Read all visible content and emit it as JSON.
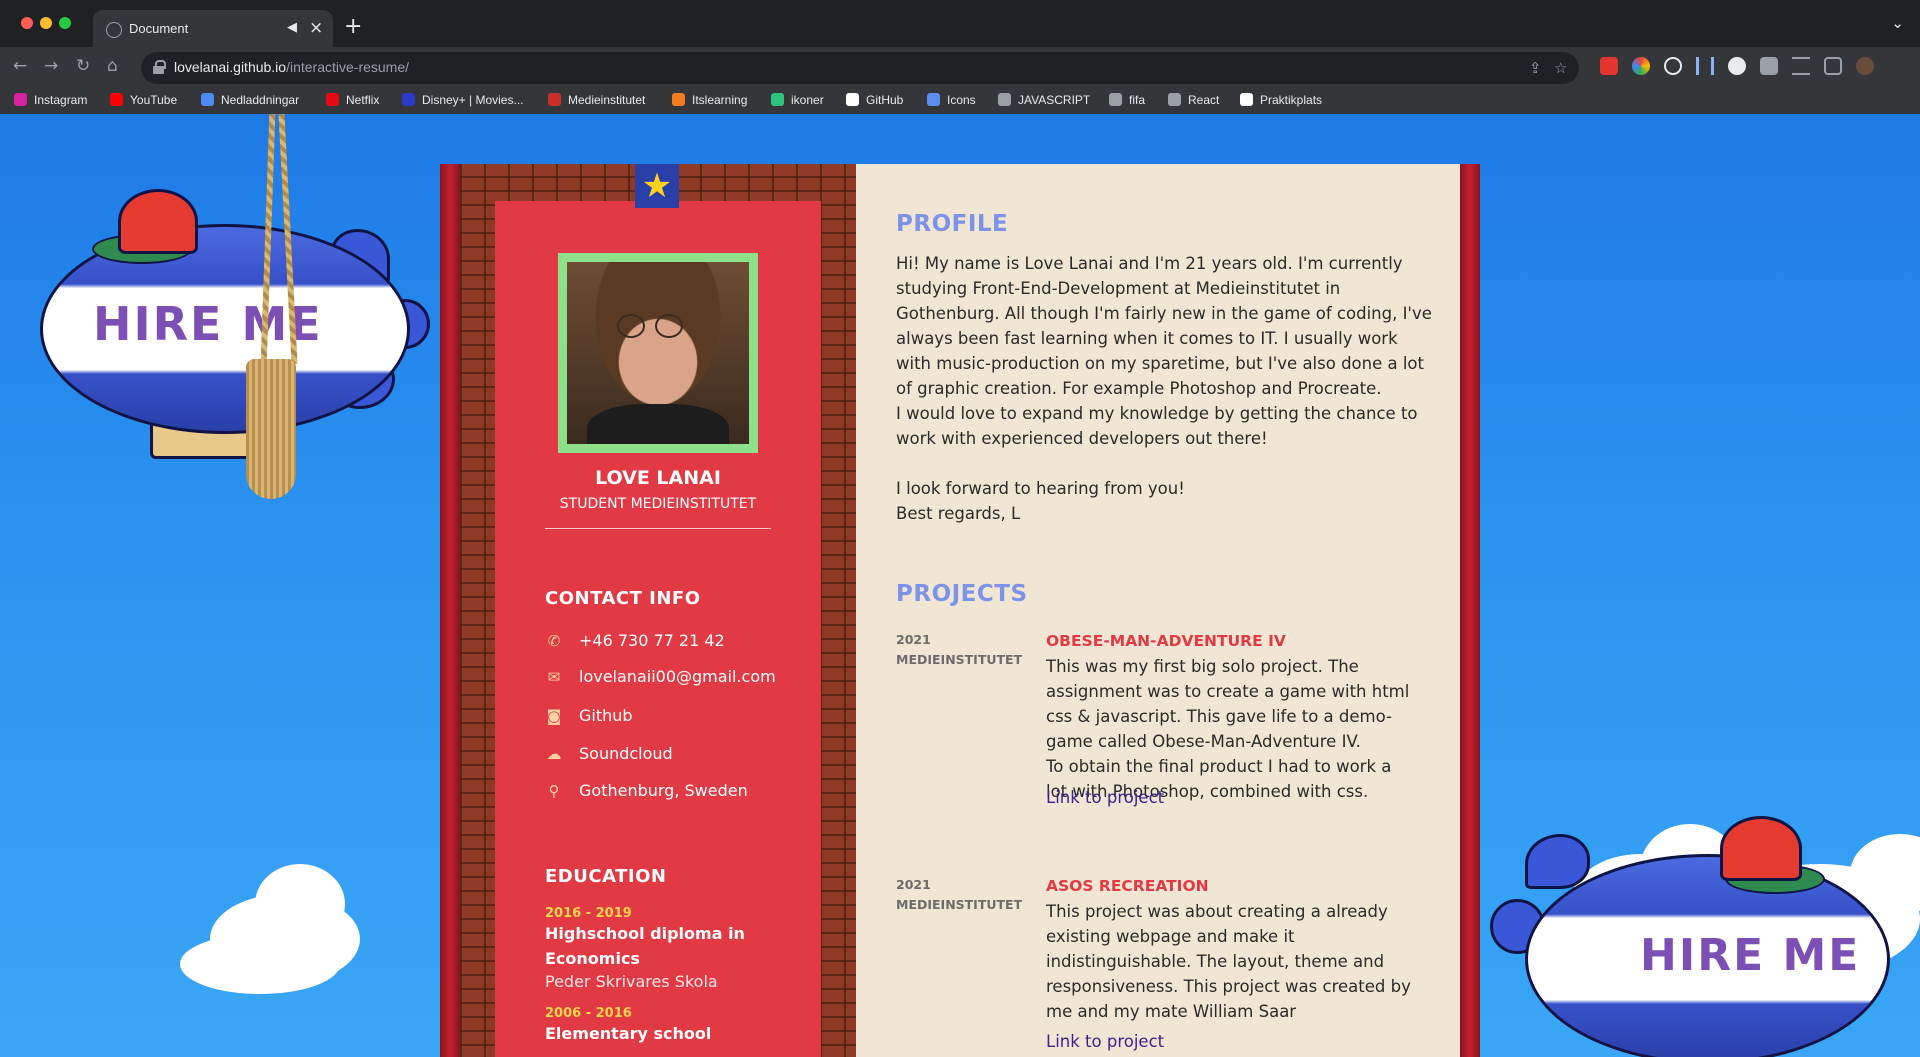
{
  "browser": {
    "tab_title": "Document",
    "url_host": "lovelanai.github.io",
    "url_path": "/interactive-resume/",
    "bookmarks": [
      "Instagram",
      "YouTube",
      "Nedladdningar",
      "Netflix",
      "Disney+ | Movies...",
      "Medieinstitutet",
      "Itslearning",
      "ikoner",
      "GitHub",
      "Icons",
      "JAVASCRIPT",
      "fifa",
      "React",
      "Praktikplats"
    ],
    "bookmark_colors": [
      "#d6249f",
      "#ff0000",
      "#4c8bf5",
      "#e50914",
      "#2b3ac7",
      "#c9302c",
      "#f47c20",
      "#2ec27e",
      "#ffffff",
      "#5b8def",
      "#9aa0a6",
      "#9aa0a6",
      "#9aa0a6",
      "#ffffff"
    ]
  },
  "page": {
    "blimp_left_text": "HIRE ME",
    "blimp_right_text": "HIRE ME",
    "sidebar": {
      "name": "LOVE LANAI",
      "role": "STUDENT MEDIEINSTITUTET",
      "contact_heading": "CONTACT INFO",
      "contacts": [
        {
          "icon": "phone-icon",
          "glyph": "✆",
          "text": "+46 730 77 21 42"
        },
        {
          "icon": "mail-icon",
          "glyph": "✉",
          "text": "lovelanaii00@gmail.com"
        },
        {
          "icon": "github-icon",
          "glyph": "◙",
          "text": "Github"
        },
        {
          "icon": "soundcloud-icon",
          "glyph": "☁",
          "text": "Soundcloud"
        },
        {
          "icon": "location-pin-icon",
          "glyph": "⚲",
          "text": "Gothenburg, Sweden"
        }
      ],
      "education_heading": "EDUCATION",
      "education": [
        {
          "years": "2016 - 2019",
          "title": "Highschool diploma in Economics",
          "school": "Peder Skrivares Skola"
        },
        {
          "years": "2006 - 2016",
          "title": "Elementary school",
          "school": ""
        }
      ]
    },
    "main": {
      "profile_heading": "PROFILE",
      "profile_lines": [
        "Hi! My name is Love Lanai and I'm 21 years old. I'm currently studying Front-End-Development at Medieinstitutet in Gothenburg. All though I'm fairly new in the game of coding, I've always been fast learning when it comes to IT. I usually work with music-production on my sparetime, but I've also done a lot of graphic creation. For example Photoshop and Procreate.",
        "I would love to expand my knowledge by getting the chance to work with experienced developers out there!",
        "",
        "I look forward to hearing from you!",
        "Best regards, L"
      ],
      "projects_heading": "PROJECTS",
      "projects": [
        {
          "year": "2021",
          "org": "MEDIEINSTITUTET",
          "title": "OBESE-MAN-ADVENTURE IV",
          "desc": "This was my first big solo project. The assignment was to create a game with html css & javascript. This gave life to a demo-game called Obese-Man-Adventure IV.",
          "desc2": "To obtain the final product I had to work a lot with Photoshop, combined with css.",
          "link": "Link to project"
        },
        {
          "year": "2021",
          "org": "MEDIEINSTITUTET",
          "title": "ASOS RECREATION",
          "desc": "This project was about creating a already existing webpage and make it indistinguishable. The layout, theme and responsiveness. This project was created by me and my mate William Saar",
          "desc2": "",
          "link": "Link to project"
        }
      ]
    }
  }
}
